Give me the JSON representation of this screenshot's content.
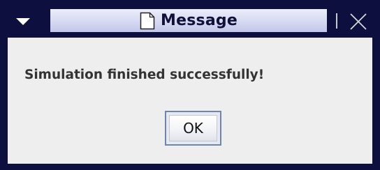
{
  "window": {
    "title": "Message",
    "title_icon": "document-icon",
    "menu_icon": "window-menu-triangle-icon",
    "close_icon": "close-x-icon"
  },
  "dialog": {
    "message": "Simulation finished successfully!",
    "ok_label": "OK"
  },
  "colors": {
    "frame": "#0d0f3e",
    "title_gradient_top": "#eceefa",
    "title_gradient_bottom": "#c3c7e8",
    "content_background": "#eeeeee",
    "button_border": "#6d86ad"
  }
}
